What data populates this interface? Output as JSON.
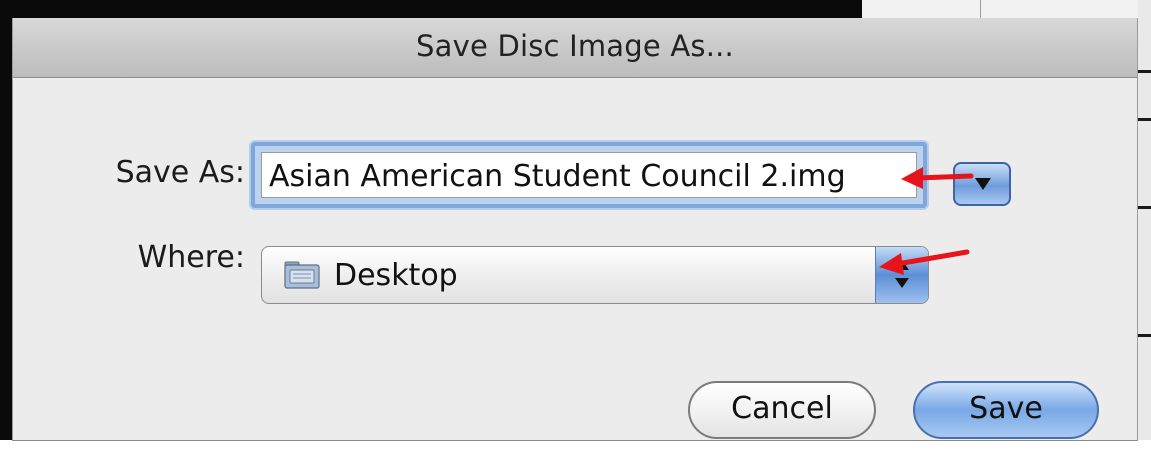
{
  "dialog": {
    "title": "Save Disc Image As..."
  },
  "form": {
    "save_as_label": "Save As:",
    "save_as_value": "Asian American Student Council 2.img",
    "where_label": "Where:",
    "where_value": "Desktop"
  },
  "buttons": {
    "cancel": "Cancel",
    "save": "Save"
  },
  "annotations": {
    "arrow_color": "#e8141b"
  },
  "icons": {
    "folder": "folder-icon",
    "expand": "triangle-down-icon",
    "popup": "up-down-arrows-icon"
  }
}
